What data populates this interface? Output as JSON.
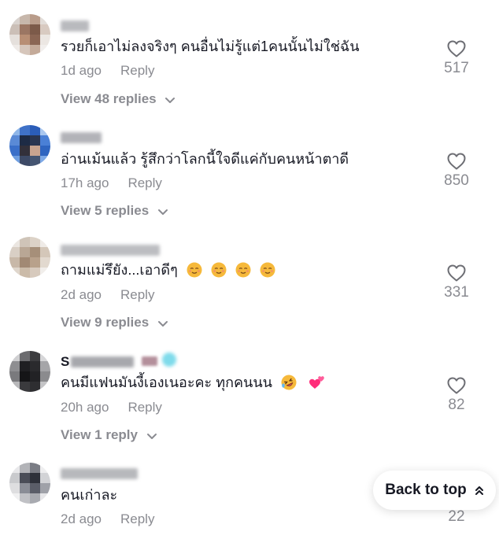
{
  "comments": [
    {
      "text": "รวยก็เอาไม่ลงจริงๆ คนอื่นไม่รู้แต่1คนนั้นไม่ใช่ฉัน",
      "time": "1d ago",
      "reply_label": "Reply",
      "likes": "517",
      "view_replies": "View 48 replies"
    },
    {
      "text": "อ่านเม้นแล้ว รู้สึกว่าโลกนี้ใจดีแค่กับคนหน้าตาดี",
      "time": "17h ago",
      "reply_label": "Reply",
      "likes": "850",
      "view_replies": "View 5 replies"
    },
    {
      "text": "ถามแม่รึยัง...เอาดีๆ",
      "emojis": [
        "relieved-face",
        "relieved-face",
        "relieved-face",
        "relieved-face"
      ],
      "time": "2d ago",
      "reply_label": "Reply",
      "likes": "331",
      "view_replies": "View 9 replies"
    },
    {
      "username_prefix": "S",
      "text": "คนมีแฟนมันงี้เองเนอะคะ ทุกคนนน",
      "emojis": [
        "rolling-laughing-face",
        "two-hearts"
      ],
      "time": "20h ago",
      "reply_label": "Reply",
      "likes": "82",
      "view_replies": "View 1 reply"
    },
    {
      "text": "คนเก่าละ",
      "time": "2d ago",
      "reply_label": "Reply",
      "likes": "22"
    }
  ],
  "back_to_top": {
    "label": "Back to top"
  },
  "colors": {
    "muted": "#8a8b91",
    "text": "#161823",
    "emoji": "#f6b93b",
    "heart_emoji": "#ff2d7a"
  }
}
